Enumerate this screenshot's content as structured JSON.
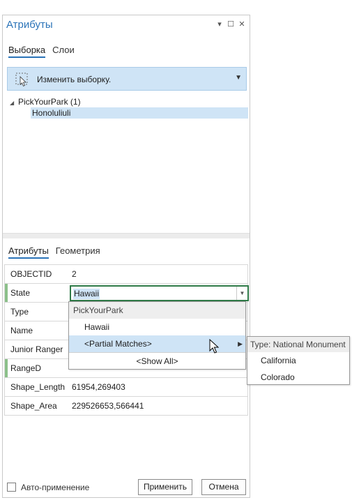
{
  "window": {
    "title": "Атрибуты",
    "pin_icon": "pin-icon",
    "maximize_icon": "maximize-icon",
    "close_icon": "close-icon"
  },
  "top_tabs": [
    {
      "label": "Выборка",
      "active": true
    },
    {
      "label": "Слои",
      "active": false
    }
  ],
  "selection_bar": {
    "label": "Изменить выборку.",
    "icon": "select-by-rectangle-icon"
  },
  "tree": {
    "parent": "PickYourPark (1)",
    "child": "Honoluliuli"
  },
  "bottom_tabs": [
    {
      "label": "Атрибуты",
      "active": true
    },
    {
      "label": "Геометрия",
      "active": false
    }
  ],
  "attributes": [
    {
      "name": "OBJECTID",
      "value": "2"
    },
    {
      "name": "State",
      "value": "Hawaii"
    },
    {
      "name": "Type",
      "value": ""
    },
    {
      "name": "Name",
      "value": ""
    },
    {
      "name": "Junior Ranger",
      "value": ""
    },
    {
      "name": "RangeD",
      "value": ""
    },
    {
      "name": "Shape_Length",
      "value": "61954,269403"
    },
    {
      "name": "Shape_Area",
      "value": "229526653,566441"
    }
  ],
  "dropdown": {
    "header": "PickYourPark",
    "items": [
      "Hawaii",
      "<Partial Matches>"
    ],
    "show_all": "<Show All>"
  },
  "submenu": {
    "header": "Type: National Monument",
    "items": [
      "California",
      "Colorado"
    ]
  },
  "footer": {
    "auto_apply_label": "Авто-применение",
    "apply_label": "Применить",
    "cancel_label": "Отмена"
  },
  "colors": {
    "accent": "#2a73b8",
    "selection": "#cfe4f6",
    "required_marker": "#8cc08a",
    "active_field_border": "#2f7a48"
  }
}
